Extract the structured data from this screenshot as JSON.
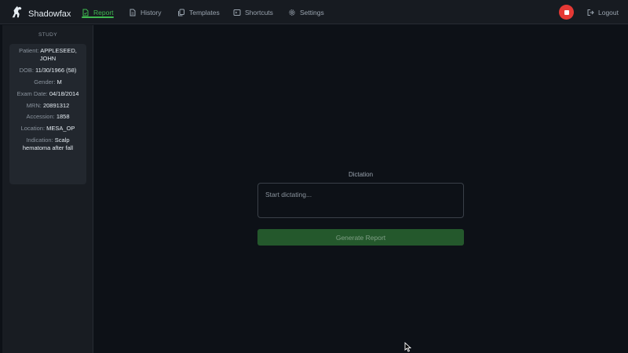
{
  "app": {
    "name": "Shadowfax"
  },
  "nav": {
    "items": [
      {
        "label": "Report",
        "icon": "document-icon",
        "active": true
      },
      {
        "label": "History",
        "icon": "file-icon",
        "active": false
      },
      {
        "label": "Templates",
        "icon": "copy-icon",
        "active": false
      },
      {
        "label": "Shortcuts",
        "icon": "terminal-icon",
        "active": false
      },
      {
        "label": "Settings",
        "icon": "gear-icon",
        "active": false
      }
    ],
    "logout_label": "Logout"
  },
  "sidebar": {
    "title": "STUDY",
    "fields": [
      {
        "label": "Patient:",
        "value": "APPLESEED, JOHN"
      },
      {
        "label": "DOB:",
        "value": "11/30/1966 (58)"
      },
      {
        "label": "Gender:",
        "value": "M"
      },
      {
        "label": "Exam Date:",
        "value": "04/18/2014"
      },
      {
        "label": "MRN:",
        "value": "20891312"
      },
      {
        "label": "Accession:",
        "value": "1858"
      },
      {
        "label": "Location:",
        "value": "MESA_OP"
      },
      {
        "label": "Indication:",
        "value": "Scalp hematoma after fall"
      }
    ]
  },
  "main": {
    "dictation_label": "Dictation",
    "dictation_placeholder": "Start dictating...",
    "dictation_value": "",
    "generate_label": "Generate Report"
  },
  "colors": {
    "accent": "#3fb950",
    "record": "#e53935",
    "generate_button": "#24582c",
    "background": "#0d1117"
  }
}
